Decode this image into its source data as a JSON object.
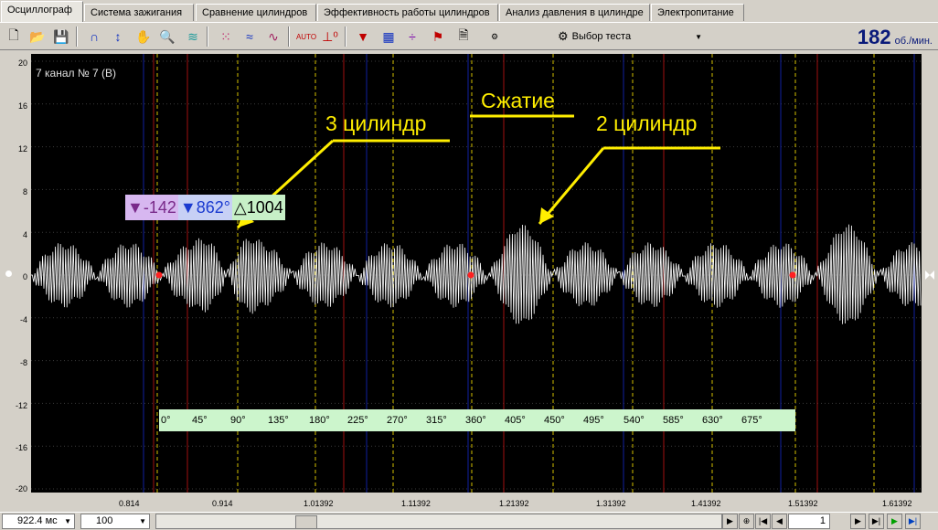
{
  "tabs": [
    "Осциллограф",
    "Система зажигания",
    "Сравнение цилиндров",
    "Эффективность работы цилиндров",
    "Анализ давления в цилиндре",
    "Электропитание"
  ],
  "toolbar": {
    "icons": [
      "new-file-icon",
      "open-folder-icon",
      "save-icon",
      "waveform-arc-icon",
      "cursor-arrows-icon",
      "hand-icon",
      "zoom-icon",
      "stack-icon",
      "scatter-icon",
      "overlay-icon",
      "sine-icon",
      "auto-icon",
      "zero-icon",
      "filter-icon",
      "table-icon",
      "split-icon",
      "flag-icon",
      "document-icon",
      "auto-gauge-icon"
    ],
    "test_select_label": "Выбор теста",
    "rpm_value": "182",
    "rpm_unit": "об./мин."
  },
  "scope": {
    "channel_label": "7  канал № 7 (В)",
    "y_ticks": [
      "20",
      "16",
      "12",
      "8",
      "4",
      "0",
      "-4",
      "-8",
      "-12",
      "-16",
      "-20"
    ],
    "x_ticks": [
      "0.814",
      "0.914",
      "1.01392",
      "1.11392",
      "1.21392",
      "1.31392",
      "1.41392",
      "1.51392",
      "1.61392"
    ],
    "measure": {
      "m1": "-142",
      "m2": "862°",
      "delta": "1004"
    },
    "annotations": {
      "compression": "Сжатие",
      "cyl3": "3 цилиндр",
      "cyl2": "2 цилиндр"
    },
    "degree_ticks": [
      "0°",
      "45°",
      "90°",
      "135°",
      "180°",
      "225°",
      "270°",
      "315°",
      "360°",
      "405°",
      "450°",
      "495°",
      "540°",
      "585°",
      "630°",
      "675°"
    ]
  },
  "statusbar": {
    "time_scale": "922.4 мс",
    "zoom": "100",
    "page": "1"
  },
  "colors": {
    "plot_bg": "#000000",
    "trace": "#ffffff",
    "annotation": "#ffee00"
  }
}
